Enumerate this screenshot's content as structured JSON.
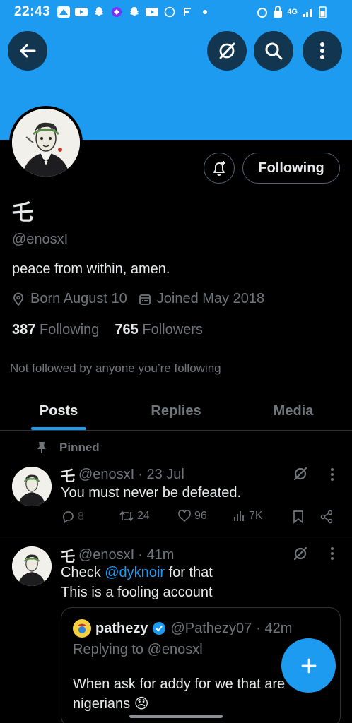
{
  "status_bar": {
    "time": "22:43",
    "network": "4G"
  },
  "profile": {
    "display_name": "乇",
    "handle": "@enosxI",
    "bio": "peace from within, amen.",
    "born": "Born August 10",
    "joined": "Joined May 2018",
    "following_count": "387",
    "following_label": "Following",
    "followers_count": "765",
    "followers_label": "Followers",
    "not_followed": "Not followed by anyone you’re following",
    "follow_button_label": "Following"
  },
  "tabs": [
    {
      "label": "Posts",
      "active": true
    },
    {
      "label": "Replies",
      "active": false
    },
    {
      "label": "Media",
      "active": false
    }
  ],
  "pinned_label": "Pinned",
  "tweets": [
    {
      "name": "乇",
      "handle": "@enosxI",
      "time": "· 23 Jul",
      "text": "You must never be defeated.",
      "replies": "8",
      "reposts": "24",
      "likes": "96",
      "views": "7K"
    },
    {
      "name": "乇",
      "handle": "@enosxI",
      "time": "· 41m",
      "text_before": "Check ",
      "mention": "@dyknoir",
      "text_after": " for that",
      "text_line2": "This is a fooling account"
    }
  ],
  "quote": {
    "name": "pathezy",
    "handle": "@Pathezy07",
    "time": "· 42m",
    "replying": "Replying to @enosxl",
    "text_line1": "When ask for addy for we that are",
    "text_line2": "nigerians 😞"
  },
  "colors": {
    "accent": "#1d9bf0",
    "muted": "#71767b",
    "text": "#e7e9ea",
    "border": "#2f3336"
  },
  "icons": [
    "back-arrow-icon",
    "grok-icon",
    "search-icon",
    "more-vertical-icon",
    "bell-plus-icon",
    "location-icon",
    "calendar-icon",
    "pin-icon",
    "reply-icon",
    "repost-icon",
    "like-icon",
    "views-icon",
    "bookmark-icon",
    "share-icon",
    "verified-icon",
    "plus-icon"
  ]
}
